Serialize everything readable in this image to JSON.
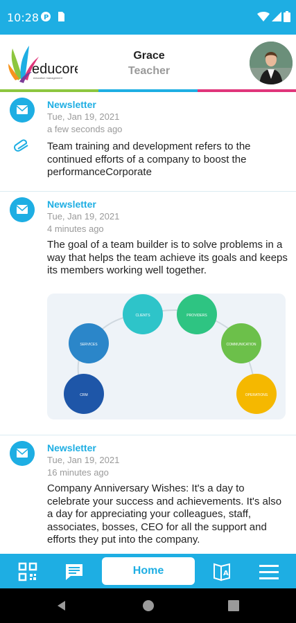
{
  "status_bar": {
    "time": "10:28"
  },
  "header": {
    "logo_text": "educore",
    "logo_tagline": "education management",
    "user_name": "Grace",
    "user_role": "Teacher"
  },
  "posts": [
    {
      "title": "Newsletter",
      "date": "Tue, Jan 19, 2021",
      "ago": "a few seconds ago",
      "body": "Team training and development refers to the continued efforts of a company to boost the performanceCorporate",
      "has_attachment": true
    },
    {
      "title": "Newsletter",
      "date": "Tue, Jan 19, 2021",
      "ago": "4 minutes ago",
      "body": "The goal of a team builder is to solve problems in a way that helps the team achieve its goals and keeps its members working well together.",
      "diagram": {
        "nodes": [
          "CLIENTS",
          "PROVIDERS",
          "SERVICES",
          "COMMUNICATION",
          "CRM",
          "OPERATIONS"
        ]
      }
    },
    {
      "title": "Newsletter",
      "date": "Tue, Jan 19, 2021",
      "ago": "16 minutes ago",
      "body": "Company Anniversary Wishes: It's a day to celebrate your success and achievements. It's also a day for appreciating your colleagues, staff, associates, bosses, CEO for all the support and efforts they put into the company."
    }
  ],
  "bottom_nav": {
    "home_label": "Home"
  },
  "colors": {
    "primary": "#1eaee3",
    "bar_green": "#8dc63f",
    "bar_blue": "#1eaee3",
    "bar_pink": "#e0357a"
  }
}
